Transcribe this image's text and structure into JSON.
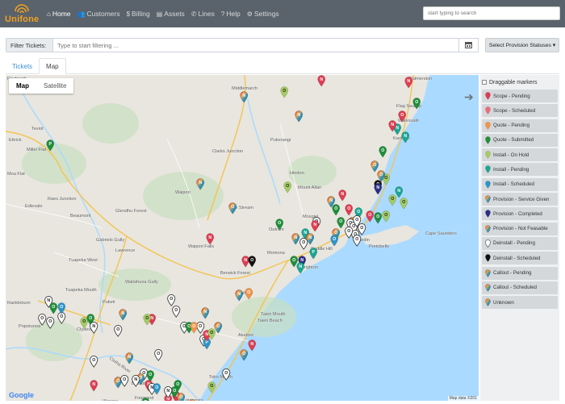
{
  "app": {
    "name": "Unifone"
  },
  "nav": [
    {
      "label": "Home",
      "icon": "home-icon",
      "glyph": "⌂",
      "active": true
    },
    {
      "label": "Customers",
      "icon": "users-icon",
      "glyph": "👥",
      "active": false
    },
    {
      "label": "Billing",
      "icon": "dollar-icon",
      "glyph": "$",
      "active": false
    },
    {
      "label": "Assets",
      "icon": "server-icon",
      "glyph": "▤",
      "active": false
    },
    {
      "label": "Lines",
      "icon": "phone-icon",
      "glyph": "✆",
      "active": false
    },
    {
      "label": "Help",
      "icon": "question-icon",
      "glyph": "?",
      "active": false
    },
    {
      "label": "Settings",
      "icon": "gear-icon",
      "glyph": "⚙",
      "active": false
    }
  ],
  "search": {
    "placeholder": "start typing to search"
  },
  "filter": {
    "label": "Filter Tickets:",
    "placeholder": "Type to start filtering ...",
    "clear_icon": "eraser-icon"
  },
  "provision_button": {
    "label": "Select Provision Statuses ▾"
  },
  "tabs": [
    {
      "label": "Tickets",
      "active": false
    },
    {
      "label": "Map",
      "active": true
    }
  ],
  "map": {
    "type_map": "Map",
    "type_satellite": "Satellite",
    "google_logo": "Google",
    "attribution": "Map data ©201",
    "colors": {
      "land": "#e8e6df",
      "sea": "#aadaff",
      "road": "#f6c350"
    },
    "places": [
      {
        "name": "Roxburgh"
      },
      {
        "name": "Ettrick"
      },
      {
        "name": "Miller Flat"
      },
      {
        "name": "Teviot"
      },
      {
        "name": "Moa Flat"
      },
      {
        "name": "Raes Junction"
      },
      {
        "name": "Edievale"
      },
      {
        "name": "Beaumont"
      },
      {
        "name": "Waipori"
      },
      {
        "name": "Glendhu Forest"
      },
      {
        "name": "Gabriels Gully"
      },
      {
        "name": "Lawrence"
      },
      {
        "name": "Tuapeka West"
      },
      {
        "name": "Tuapeka Mouth"
      },
      {
        "name": "Waitahuna Gully"
      },
      {
        "name": "Rankleburn"
      },
      {
        "name": "Popotunoa"
      },
      {
        "name": "Clydevale"
      },
      {
        "name": "Puketi"
      },
      {
        "name": "Balclutha"
      },
      {
        "name": "Finegand"
      },
      {
        "name": "Warepa"
      },
      {
        "name": "Kaitangata"
      },
      {
        "name": "Toko Mouth"
      },
      {
        "name": "Akatore"
      },
      {
        "name": "Taieri Mouth"
      },
      {
        "name": "Taieri Beach"
      },
      {
        "name": "Berwick Forest"
      },
      {
        "name": "Waihola"
      },
      {
        "name": "Momona"
      },
      {
        "name": "Brighton"
      },
      {
        "name": "Mosgiel"
      },
      {
        "name": "Saddle Hill"
      },
      {
        "name": "Dunedin"
      },
      {
        "name": "Clarks Junction"
      },
      {
        "name": "Lee Stream"
      },
      {
        "name": "Outram"
      },
      {
        "name": "Hindon"
      },
      {
        "name": "Mount Allan"
      },
      {
        "name": "Middlemarch"
      },
      {
        "name": "Pukerangi"
      },
      {
        "name": "Karitane"
      },
      {
        "name": "Waikouaiti"
      },
      {
        "name": "Flag Swamp"
      },
      {
        "name": "Palmerston"
      },
      {
        "name": "Cape Saunders"
      },
      {
        "name": "Waipori Falls"
      },
      {
        "name": "Clutha River"
      },
      {
        "name": "Portobello"
      }
    ],
    "markers": [
      {
        "status": "install-onhold",
        "label": "O"
      },
      {
        "status": "scope-pending",
        "label": "N"
      },
      {
        "status": "scope-pending",
        "label": "N"
      },
      {
        "status": "quote-submitted",
        "label": "O"
      },
      {
        "status": "install-pending",
        "label": "N"
      },
      {
        "status": "provision-notfeasible",
        "label": "N"
      },
      {
        "status": "provision-notfeasible",
        "label": "N"
      },
      {
        "status": "scope-pending",
        "label": "O"
      },
      {
        "status": "scope-pending",
        "label": "N"
      },
      {
        "status": "install-pending",
        "label": "N"
      },
      {
        "status": "quote-submitted",
        "label": "O"
      },
      {
        "status": "quote-submitted",
        "label": "P"
      },
      {
        "status": "provision-notfeasible",
        "label": "N"
      },
      {
        "status": "provision-notfeasible",
        "label": "O"
      },
      {
        "status": "deinstall-scheduled",
        "label": "O"
      },
      {
        "status": "install-onhold",
        "label": "O"
      },
      {
        "status": "install-onhold",
        "label": "O"
      },
      {
        "status": "provision-notfeasible",
        "label": "N"
      },
      {
        "status": "provision-notfeasible",
        "label": "O"
      },
      {
        "status": "provision-notfeasible",
        "label": "N"
      },
      {
        "status": "scope-pending",
        "label": "N"
      },
      {
        "status": "scope-pending",
        "label": "O"
      },
      {
        "status": "quote-submitted",
        "label": "O"
      },
      {
        "status": "quote-submitted",
        "label": "O"
      },
      {
        "status": "install-pending",
        "label": "O"
      },
      {
        "status": "install-pending",
        "label": "N"
      },
      {
        "status": "install-onhold",
        "label": "O"
      },
      {
        "status": "install-onhold",
        "label": "O"
      },
      {
        "status": "install-onhold",
        "label": "O"
      },
      {
        "status": "provision-notfeasible",
        "label": "N"
      },
      {
        "status": "provision-completed",
        "label": "N"
      },
      {
        "status": "provision-notfeasible",
        "label": "O"
      },
      {
        "status": "quote-submitted",
        "label": "O"
      },
      {
        "status": "scope-pending",
        "label": "N"
      },
      {
        "status": "deinstall-pending",
        "label": "O"
      },
      {
        "status": "deinstall-pending",
        "label": "O"
      },
      {
        "status": "deinstall-pending",
        "label": "O"
      },
      {
        "status": "deinstall-pending",
        "label": "O"
      },
      {
        "status": "deinstall-pending",
        "label": "O"
      },
      {
        "status": "deinstall-pending",
        "label": "O"
      },
      {
        "status": "deinstall-pending",
        "label": "O"
      },
      {
        "status": "deinstall-pending",
        "label": "O"
      },
      {
        "status": "provision-notfeasible",
        "label": "O"
      },
      {
        "status": "install-scheduled",
        "label": "O"
      },
      {
        "status": "scope-pending",
        "label": "O"
      },
      {
        "status": "quote-submitted",
        "label": "O"
      },
      {
        "status": "install-pending",
        "label": "N"
      },
      {
        "status": "scope-pending",
        "label": "N"
      },
      {
        "status": "provision-notfeasible",
        "label": "N"
      },
      {
        "status": "deinstall-pending",
        "label": "O"
      },
      {
        "status": "provision-completed",
        "label": "N"
      },
      {
        "status": "quote-submitted",
        "label": "O"
      },
      {
        "status": "install-pending",
        "label": "N"
      },
      {
        "status": "scope-pending",
        "label": "N"
      },
      {
        "status": "deinstall-scheduled",
        "label": "O"
      },
      {
        "status": "install-pending",
        "label": "P"
      },
      {
        "status": "provision-notfeasible",
        "label": "N"
      },
      {
        "status": "quote-pending",
        "label": "O"
      },
      {
        "status": "deinstall-pending",
        "label": "O"
      },
      {
        "status": "deinstall-pending",
        "label": "O"
      },
      {
        "status": "deinstall-pending",
        "label": "O"
      },
      {
        "status": "deinstall-pending",
        "label": "O"
      },
      {
        "status": "deinstall-pending",
        "label": "O"
      },
      {
        "status": "install-scheduled",
        "label": "P"
      },
      {
        "status": "scope-pending",
        "label": "N"
      },
      {
        "status": "install-onhold",
        "label": "O"
      },
      {
        "status": "quote-submitted",
        "label": "O"
      },
      {
        "status": "provision-notfeasible",
        "label": "N"
      },
      {
        "status": "quote-pending",
        "label": "O"
      },
      {
        "status": "provision-notfeasible",
        "label": "O"
      },
      {
        "status": "scope-pending",
        "label": "N"
      },
      {
        "status": "install-onhold",
        "label": "O"
      },
      {
        "status": "quote-submitted",
        "label": "O"
      },
      {
        "status": "deinstall-pending",
        "label": "N"
      },
      {
        "status": "deinstall-pending",
        "label": "O"
      },
      {
        "status": "provision-notfeasible",
        "label": "N"
      },
      {
        "status": "install-onhold",
        "label": "O"
      },
      {
        "status": "deinstall-pending",
        "label": "N"
      },
      {
        "status": "deinstall-pending",
        "label": "O"
      },
      {
        "status": "quote-submitted",
        "label": "O"
      },
      {
        "status": "install-scheduled",
        "label": "O"
      },
      {
        "status": "deinstall-pending",
        "label": "O"
      },
      {
        "status": "deinstall-pending",
        "label": "O"
      },
      {
        "status": "deinstall-pending",
        "label": "O"
      },
      {
        "status": "provision-notfeasible",
        "label": "N"
      },
      {
        "status": "scope-pending",
        "label": "N"
      },
      {
        "status": "provision-notfeasible",
        "label": "O"
      },
      {
        "status": "deinstall-pending",
        "label": "O"
      },
      {
        "status": "provision-notfeasible",
        "label": "O"
      },
      {
        "status": "scope-pending",
        "label": "N"
      },
      {
        "status": "deinstall-pending",
        "label": "O"
      },
      {
        "status": "quote-submitted",
        "label": "O"
      },
      {
        "status": "provision-notfeasible",
        "label": "O"
      },
      {
        "status": "scope-pending",
        "label": "N"
      },
      {
        "status": "deinstall-pending",
        "label": "N"
      },
      {
        "status": "deinstall-pending",
        "label": "N"
      },
      {
        "status": "deinstall-pending",
        "label": "O"
      },
      {
        "status": "quote-submitted",
        "label": "O"
      },
      {
        "status": "install-scheduled",
        "label": "O"
      },
      {
        "status": "scope-pending",
        "label": "N"
      },
      {
        "status": "scope-pending",
        "label": "N"
      },
      {
        "status": "quote-submitted",
        "label": "O"
      },
      {
        "status": "quote-submitted",
        "label": "O"
      },
      {
        "status": "provision-notfeasible",
        "label": "O"
      },
      {
        "status": "provision-notfeasible",
        "label": "O"
      },
      {
        "status": "deinstall-pending",
        "label": "N"
      },
      {
        "status": "install-onhold",
        "label": "O"
      },
      {
        "status": "deinstall-pending",
        "label": "O"
      }
    ]
  },
  "legend": {
    "draggable_label": "Draggable markers",
    "next_icon": "arrow-right-icon",
    "items": [
      {
        "key": "scope-pending",
        "label": "Scope - Pending",
        "color": "#e03c52",
        "style": "solid"
      },
      {
        "key": "scope-scheduled",
        "label": "Scope - Scheduled",
        "color": "#f06a7a",
        "style": "solid"
      },
      {
        "key": "quote-pending",
        "label": "Quote - Pending",
        "color": "#f29547",
        "style": "solid"
      },
      {
        "key": "quote-submitted",
        "label": "Quote - Submitted",
        "color": "#1e8f3a",
        "style": "solid"
      },
      {
        "key": "install-onhold",
        "label": "Install - On Hold",
        "color": "#a5cc63",
        "style": "solid"
      },
      {
        "key": "install-pending",
        "label": "Install - Pending",
        "color": "#1aa694",
        "style": "solid"
      },
      {
        "key": "install-scheduled",
        "label": "Install - Scheduled",
        "color": "#2d95c8",
        "style": "solid"
      },
      {
        "key": "provision-servicegiven",
        "label": "Provision - Service Given",
        "color": "#2d95c8",
        "style": "multi"
      },
      {
        "key": "provision-completed",
        "label": "Provision - Completed",
        "color": "#2c2f82",
        "style": "solid"
      },
      {
        "key": "provision-notfeasible",
        "label": "Provision - Not Feasable",
        "color": "#f2a23a",
        "style": "multi"
      },
      {
        "key": "deinstall-pending",
        "label": "Deinstall - Pending",
        "color": "#ffffff",
        "style": "outline"
      },
      {
        "key": "deinstall-scheduled",
        "label": "Deinstall - Scheduled",
        "color": "#111111",
        "style": "solid"
      },
      {
        "key": "callout-pending",
        "label": "Callout - Pending",
        "color": "#f2a23a",
        "style": "multi"
      },
      {
        "key": "callout-scheduled",
        "label": "Callout - Scheduled",
        "color": "#2d95c8",
        "style": "multi"
      },
      {
        "key": "unknown",
        "label": "Unknown",
        "color": "#e8b23a",
        "style": "multi"
      }
    ]
  }
}
